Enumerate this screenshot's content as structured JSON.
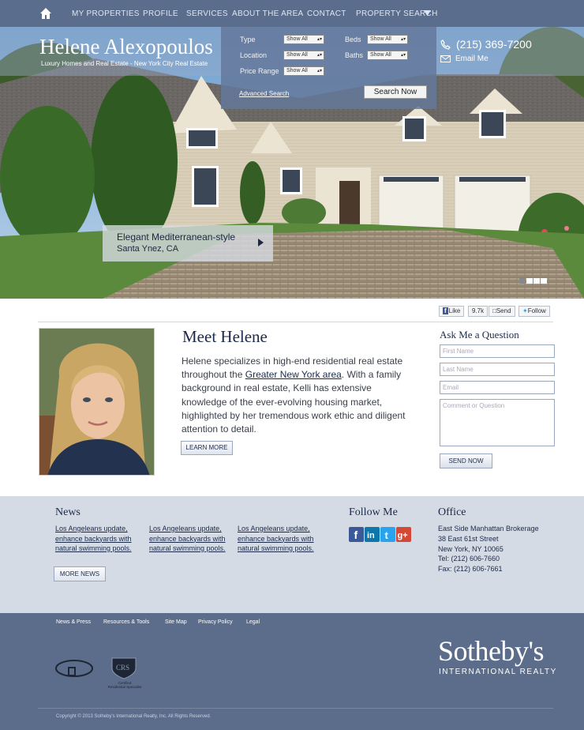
{
  "nav": {
    "items": [
      {
        "label": "MY PROPERTIES"
      },
      {
        "label": "PROFILE"
      },
      {
        "label": "SERVICES"
      },
      {
        "label": "ABOUT THE AREA"
      },
      {
        "label": "CONTACT"
      },
      {
        "label": "PROPERTY SEARCH"
      }
    ]
  },
  "header": {
    "name": "Helene Alexopoulos",
    "tagline": "Luxury Homes and Real Estate - New York City Real Estate",
    "phone": "(215) 369-7200",
    "email_label": "Email Me"
  },
  "search": {
    "type_label": "Type",
    "location_label": "Location",
    "price_label": "Price Range",
    "beds_label": "Beds",
    "baths_label": "Baths",
    "select_value": "Show All",
    "advanced_label": "Advanced Search",
    "button_label": "Search Now"
  },
  "hero": {
    "caption_title": "Elegant Mediterranean-style",
    "caption_location": "Santa Ynez, CA",
    "slides_total": 4,
    "slide_active": 1
  },
  "social": {
    "like_label": "Like",
    "like_count": "9.7k",
    "send_label": "Send",
    "follow_label": "Follow"
  },
  "meet": {
    "heading": "Meet Helene",
    "text_before": "Helene specializes in high-end residential real estate throughout the ",
    "link_text": "Greater New York area",
    "text_after": ". With a family background in real estate, Kelli has extensive knowledge of the ever-evolving housing market, highlighted by her tremendous work ethic and diligent attention to detail.",
    "button_label": "LEARN MORE"
  },
  "form": {
    "heading": "Ask Me a Question",
    "first_name_placeholder": "First Name",
    "last_name_placeholder": "Last Name",
    "email_placeholder": "Email",
    "comment_placeholder": "Comment or Question",
    "send_label": "SEND NOW"
  },
  "news": {
    "heading": "News",
    "items": [
      {
        "text": "Los Angeleans update, enhance backyards with natural swimming pools."
      },
      {
        "text": "Los Angeleans update, enhance backyards with natural swimming pools."
      },
      {
        "text": "Los Angeleans update, enhance backyards with natural swimming pools."
      }
    ],
    "more_label": "MORE NEWS"
  },
  "follow": {
    "heading": "Follow Me",
    "icons": [
      "facebook-icon",
      "linkedin-icon",
      "twitter-icon",
      "google-plus-icon"
    ]
  },
  "office": {
    "heading": "Office",
    "lines": [
      "East Side Manhattan Brokerage",
      "38 East 61st Street",
      "New York, NY  10065",
      "Tel: (212) 606-7660",
      "Fax: (212) 606-7661"
    ]
  },
  "footer": {
    "links": [
      "News & Press",
      "Resources & Tools",
      "Site Map",
      "Privacy Policy",
      "Legal"
    ],
    "brand": "Sotheby's",
    "brand_sub": "INTERNATIONAL REALTY",
    "badge2_line1": "CRS",
    "badge2_line2": "Certified",
    "badge2_line3": "Residential Specialist",
    "copyright": "Copyright © 2013 Sotheby's International Realty, Inc. All Rights Reserved."
  },
  "colors": {
    "nav_bg": "#5a6d8c",
    "footer_bg": "#5b6d8b",
    "mid_bg": "#d5dbe4",
    "heading": "#1c2a4a"
  }
}
